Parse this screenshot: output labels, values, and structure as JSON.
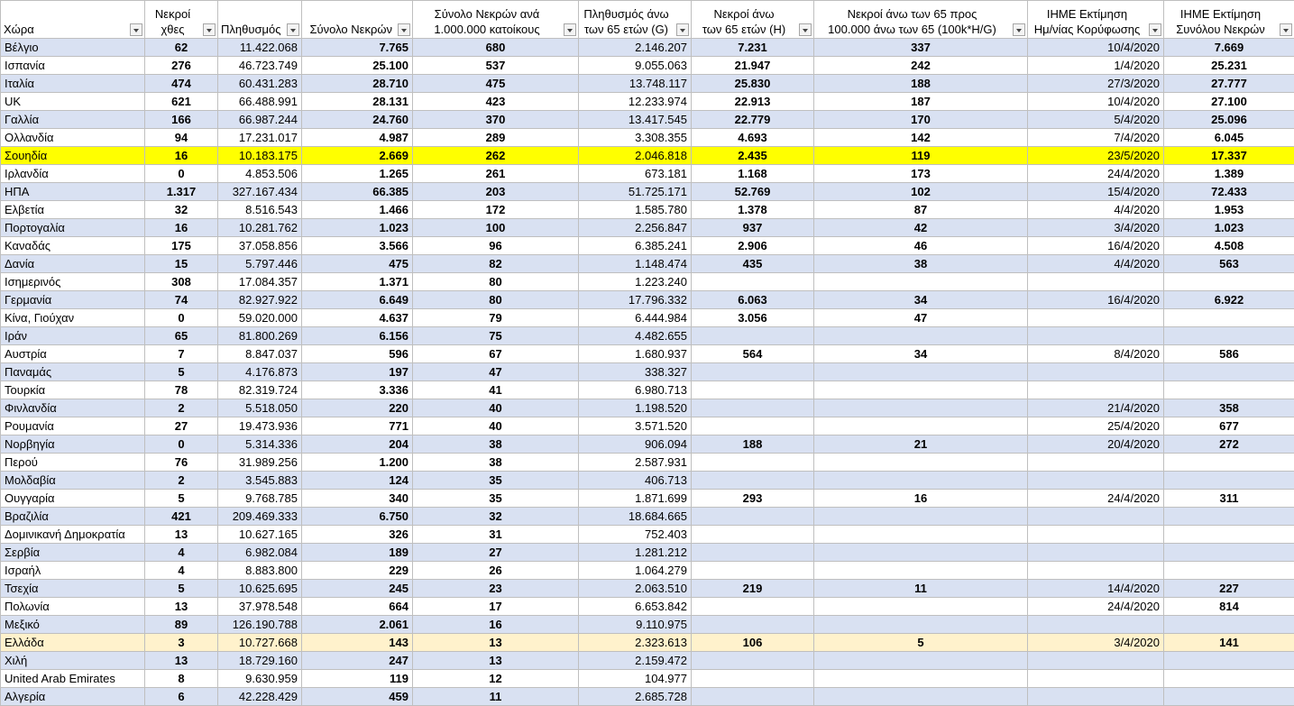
{
  "headers": [
    {
      "l1": "",
      "l2": "Χώρα"
    },
    {
      "l1": "Νεκροί",
      "l2": "χθες"
    },
    {
      "l1": "",
      "l2": "Πληθυσμός"
    },
    {
      "l1": "",
      "l2": "Σύνολο Νεκρών"
    },
    {
      "l1": "Σύνολο Νεκρών ανά",
      "l2": "1.000.000 κατοίκους"
    },
    {
      "l1": "Πληθυσμός άνω",
      "l2": "των 65 ετών (G)"
    },
    {
      "l1": "Νεκροί άνω",
      "l2": "των 65 ετών (H)"
    },
    {
      "l1": "Νεκροί άνω των 65 προς",
      "l2": "100.000 άνω των 65 (100k*H/G)"
    },
    {
      "l1": "IHME Εκτίμηση",
      "l2": "Ημ/νίας Κορύφωσης"
    },
    {
      "l1": "IHME Εκτίμηση",
      "l2": "Συνόλου Νεκρών"
    }
  ],
  "rows": [
    [
      "Βέλγιο",
      "62",
      "11.422.068",
      "7.765",
      "680",
      "2.146.207",
      "7.231",
      "337",
      "10/4/2020",
      "7.669"
    ],
    [
      "Ισπανία",
      "276",
      "46.723.749",
      "25.100",
      "537",
      "9.055.063",
      "21.947",
      "242",
      "1/4/2020",
      "25.231"
    ],
    [
      "Ιταλία",
      "474",
      "60.431.283",
      "28.710",
      "475",
      "13.748.117",
      "25.830",
      "188",
      "27/3/2020",
      "27.777"
    ],
    [
      "UK",
      "621",
      "66.488.991",
      "28.131",
      "423",
      "12.233.974",
      "22.913",
      "187",
      "10/4/2020",
      "27.100"
    ],
    [
      "Γαλλία",
      "166",
      "66.987.244",
      "24.760",
      "370",
      "13.417.545",
      "22.779",
      "170",
      "5/4/2020",
      "25.096"
    ],
    [
      "Ολλανδία",
      "94",
      "17.231.017",
      "4.987",
      "289",
      "3.308.355",
      "4.693",
      "142",
      "7/4/2020",
      "6.045"
    ],
    [
      "Σουηδία",
      "16",
      "10.183.175",
      "2.669",
      "262",
      "2.046.818",
      "2.435",
      "119",
      "23/5/2020",
      "17.337"
    ],
    [
      "Ιρλανδία",
      "0",
      "4.853.506",
      "1.265",
      "261",
      "673.181",
      "1.168",
      "173",
      "24/4/2020",
      "1.389"
    ],
    [
      "ΗΠΑ",
      "1.317",
      "327.167.434",
      "66.385",
      "203",
      "51.725.171",
      "52.769",
      "102",
      "15/4/2020",
      "72.433"
    ],
    [
      "Ελβετία",
      "32",
      "8.516.543",
      "1.466",
      "172",
      "1.585.780",
      "1.378",
      "87",
      "4/4/2020",
      "1.953"
    ],
    [
      "Πορτογαλία",
      "16",
      "10.281.762",
      "1.023",
      "100",
      "2.256.847",
      "937",
      "42",
      "3/4/2020",
      "1.023"
    ],
    [
      "Καναδάς",
      "175",
      "37.058.856",
      "3.566",
      "96",
      "6.385.241",
      "2.906",
      "46",
      "16/4/2020",
      "4.508"
    ],
    [
      "Δανία",
      "15",
      "5.797.446",
      "475",
      "82",
      "1.148.474",
      "435",
      "38",
      "4/4/2020",
      "563"
    ],
    [
      "Ισημερινός",
      "308",
      "17.084.357",
      "1.371",
      "80",
      "1.223.240",
      "",
      "",
      "",
      ""
    ],
    [
      "Γερμανία",
      "74",
      "82.927.922",
      "6.649",
      "80",
      "17.796.332",
      "6.063",
      "34",
      "16/4/2020",
      "6.922"
    ],
    [
      "Κίνα, Γιούχαν",
      "0",
      "59.020.000",
      "4.637",
      "79",
      "6.444.984",
      "3.056",
      "47",
      "",
      ""
    ],
    [
      "Ιράν",
      "65",
      "81.800.269",
      "6.156",
      "75",
      "4.482.655",
      "",
      "",
      "",
      ""
    ],
    [
      "Αυστρία",
      "7",
      "8.847.037",
      "596",
      "67",
      "1.680.937",
      "564",
      "34",
      "8/4/2020",
      "586"
    ],
    [
      "Παναμάς",
      "5",
      "4.176.873",
      "197",
      "47",
      "338.327",
      "",
      "",
      "",
      ""
    ],
    [
      "Τουρκία",
      "78",
      "82.319.724",
      "3.336",
      "41",
      "6.980.713",
      "",
      "",
      "",
      ""
    ],
    [
      "Φινλανδία",
      "2",
      "5.518.050",
      "220",
      "40",
      "1.198.520",
      "",
      "",
      "21/4/2020",
      "358"
    ],
    [
      "Ρουμανία",
      "27",
      "19.473.936",
      "771",
      "40",
      "3.571.520",
      "",
      "",
      "25/4/2020",
      "677"
    ],
    [
      "Νορβηγία",
      "0",
      "5.314.336",
      "204",
      "38",
      "906.094",
      "188",
      "21",
      "20/4/2020",
      "272"
    ],
    [
      "Περού",
      "76",
      "31.989.256",
      "1.200",
      "38",
      "2.587.931",
      "",
      "",
      "",
      ""
    ],
    [
      "Μολδαβία",
      "2",
      "3.545.883",
      "124",
      "35",
      "406.713",
      "",
      "",
      "",
      ""
    ],
    [
      "Ουγγαρία",
      "5",
      "9.768.785",
      "340",
      "35",
      "1.871.699",
      "293",
      "16",
      "24/4/2020",
      "311"
    ],
    [
      "Βραζιλία",
      "421",
      "209.469.333",
      "6.750",
      "32",
      "18.684.665",
      "",
      "",
      "",
      ""
    ],
    [
      "Δομινικανή Δημοκρατία",
      "13",
      "10.627.165",
      "326",
      "31",
      "752.403",
      "",
      "",
      "",
      ""
    ],
    [
      "Σερβία",
      "4",
      "6.982.084",
      "189",
      "27",
      "1.281.212",
      "",
      "",
      "",
      ""
    ],
    [
      "Ισραήλ",
      "4",
      "8.883.800",
      "229",
      "26",
      "1.064.279",
      "",
      "",
      "",
      ""
    ],
    [
      "Τσεχία",
      "5",
      "10.625.695",
      "245",
      "23",
      "2.063.510",
      "219",
      "11",
      "14/4/2020",
      "227"
    ],
    [
      "Πολωνία",
      "13",
      "37.978.548",
      "664",
      "17",
      "6.653.842",
      "",
      "",
      "24/4/2020",
      "814"
    ],
    [
      "Μεξικό",
      "89",
      "126.190.788",
      "2.061",
      "16",
      "9.110.975",
      "",
      "",
      "",
      ""
    ],
    [
      "Ελλάδα",
      "3",
      "10.727.668",
      "143",
      "13",
      "2.323.613",
      "106",
      "5",
      "3/4/2020",
      "141"
    ],
    [
      "Χιλή",
      "13",
      "18.729.160",
      "247",
      "13",
      "2.159.472",
      "",
      "",
      "",
      ""
    ],
    [
      "United Arab Emirates",
      "8",
      "9.630.959",
      "119",
      "12",
      "104.977",
      "",
      "",
      "",
      ""
    ],
    [
      "Αλγερία",
      "6",
      "42.228.429",
      "459",
      "11",
      "2.685.728",
      "",
      "",
      "",
      ""
    ]
  ],
  "highlights": {
    "primary_row": "Σουηδία",
    "primary_color": "#ffff00",
    "secondary_row": "Ελλάδα",
    "secondary_color": "#fff2cc"
  },
  "band_color": "#d9e1f2"
}
